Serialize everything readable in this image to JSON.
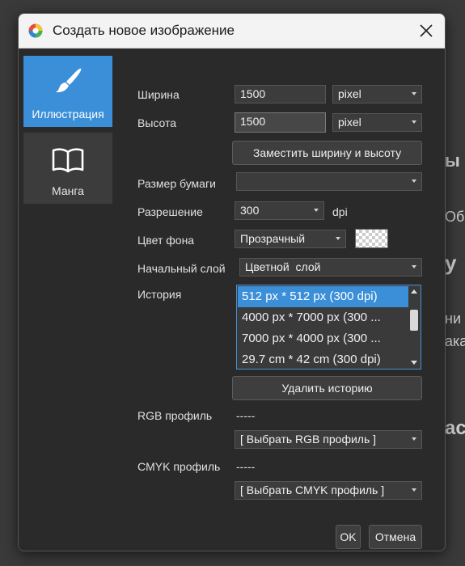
{
  "background": {
    "fragments": [
      "ы",
      "Об",
      "у",
      "ни",
      "ака",
      "ас"
    ]
  },
  "dialog": {
    "title": "Создать новое изображение",
    "tabs": [
      {
        "label": "Иллюстрация",
        "icon": "brush-icon",
        "active": true
      },
      {
        "label": "Манга",
        "icon": "book-icon",
        "active": false
      }
    ],
    "width": {
      "label": "Ширина",
      "value": "1500",
      "unit": "pixel"
    },
    "height": {
      "label": "Высота",
      "value": "1500",
      "unit": "pixel"
    },
    "swap_button": "Заместить ширину и высоту",
    "paper_size": {
      "label": "Размер бумаги",
      "value": ""
    },
    "resolution": {
      "label": "Разрешение",
      "value": "300",
      "unit": "dpi"
    },
    "bg_color": {
      "label": "Цвет фона",
      "value": "Прозрачный"
    },
    "initial_layer": {
      "label": "Начальный слой",
      "value": "Цветной  слой"
    },
    "history": {
      "label": "История",
      "items": [
        "512 px * 512 px (300 dpi)",
        "4000 px * 7000 px (300 ...",
        "7000 px * 4000 px (300 ...",
        "29.7 cm * 42 cm (300 dpi)"
      ],
      "selected_index": 0
    },
    "delete_history_button": "Удалить историю",
    "rgb_profile": {
      "label": "RGB профиль",
      "value": "-----",
      "select": "[ Выбрать RGB профиль ]"
    },
    "cmyk_profile": {
      "label": "CMYK профиль",
      "value": "-----",
      "select": "[ Выбрать CMYK профиль ]"
    },
    "ok_button": "OK",
    "cancel_button": "Отмена"
  },
  "colors": {
    "accent": "#3b8fd8",
    "panel": "#2a2a2a",
    "control": "#3c3c3c"
  }
}
